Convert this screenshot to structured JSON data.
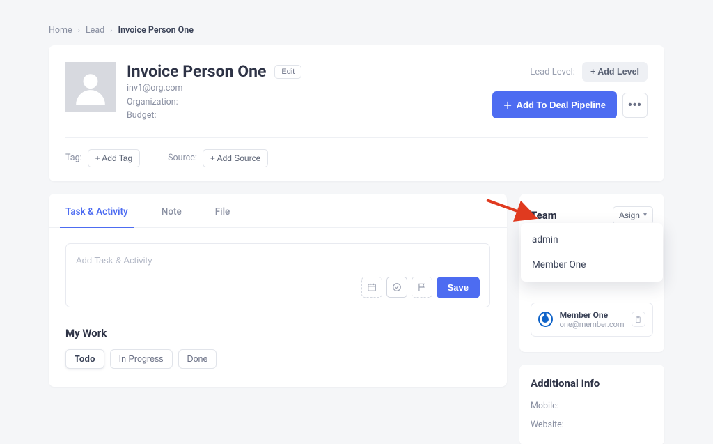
{
  "breadcrumb": {
    "home": "Home",
    "lead": "Lead",
    "current": "Invoice Person One"
  },
  "person": {
    "name": "Invoice Person One",
    "edit_label": "Edit",
    "email": "inv1@org.com",
    "org_label": "Organization:",
    "budget_label": "Budget:"
  },
  "lead_level": {
    "label": "Lead Level:",
    "add_label": "+ Add Level"
  },
  "actions": {
    "add_pipeline_label": "Add To Deal Pipeline"
  },
  "tag": {
    "label": "Tag:",
    "add_label": "+ Add Tag"
  },
  "source": {
    "label": "Source:",
    "add_label": "+ Add Source"
  },
  "tabs": {
    "task": "Task & Activity",
    "note": "Note",
    "file": "File"
  },
  "task_input": {
    "placeholder": "Add Task & Activity",
    "save_label": "Save"
  },
  "mywork": {
    "title": "My Work",
    "filters": {
      "todo": "Todo",
      "in_progress": "In Progress",
      "done": "Done"
    }
  },
  "team": {
    "title": "Team",
    "assign_label": "Asign",
    "options": [
      "admin",
      "Member One"
    ],
    "member": {
      "name": "Member One",
      "email": "one@member.com"
    }
  },
  "additional_info": {
    "title": "Additional Info",
    "mobile_label": "Mobile:",
    "website_label": "Website:"
  }
}
